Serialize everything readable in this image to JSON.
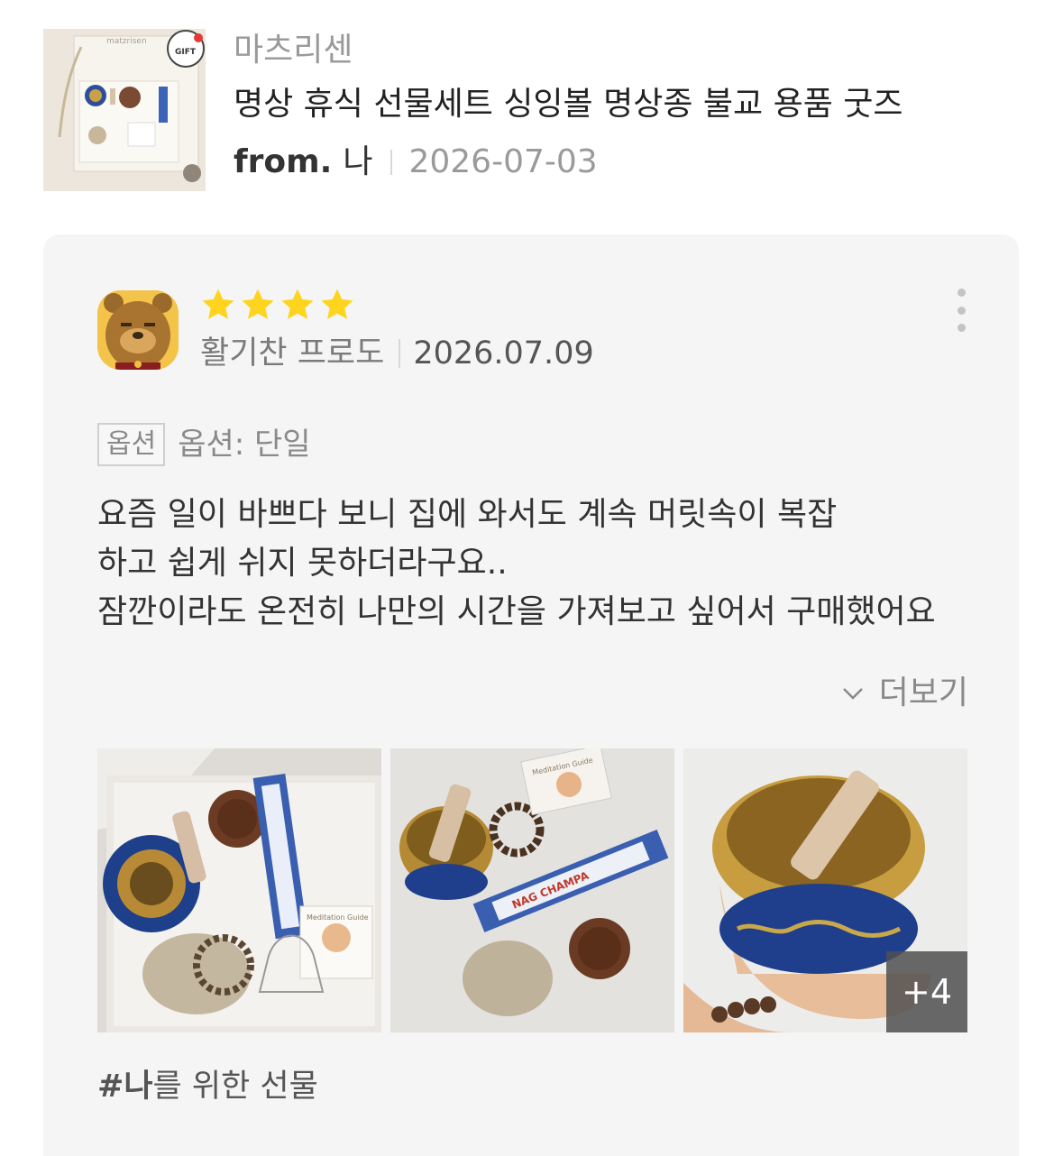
{
  "product": {
    "brand": "마츠리센",
    "title": "명상 휴식 선물세트 싱잉볼 명상종 불교 용품 굿즈",
    "thumbnail_icon": "gift-box-product-photo",
    "thumb_box_text": "matzrisen",
    "thumb_badge_text": "GIFT",
    "gift": {
      "from_label": "from.",
      "from_name": "나",
      "date": "2026-07-03"
    }
  },
  "review": {
    "avatar_icon": "bear-character-avatar",
    "rating": 4,
    "rating_max": 4,
    "reviewer_name": "활기찬 프로도",
    "date": "2026.07.09",
    "menu_icon": "more-vertical-icon",
    "option_badge": "옵션",
    "option_text": "옵션: 단일",
    "body_lines": [
      "요즘 일이 바쁘다 보니 집에 와서도 계속 머릿속이 복잡",
      "하고 쉽게 쉬지 못하더라구요..",
      "잠깐이라도 온전히 나만의 시간을 가져보고 싶어서 구매했어요"
    ],
    "more_label": "더보기",
    "photos": [
      {
        "name": "review-photo-1",
        "icon": "gift-set-open-box-photo"
      },
      {
        "name": "review-photo-2",
        "icon": "singing-bowl-items-photo"
      },
      {
        "name": "review-photo-3",
        "icon": "singing-bowl-in-hand-photo"
      }
    ],
    "photo_card_labels": [
      "Meditation Guide",
      "NAG CHAMPA"
    ],
    "extra_photos_label": "+4",
    "tag": {
      "hash": "#",
      "name": "나",
      "rest": "를 위한 선물"
    }
  },
  "colors": {
    "card_bg": "#f5f5f5",
    "star": "#ffd41e",
    "muted_text": "#9a9a9a",
    "body_text": "#333333"
  }
}
